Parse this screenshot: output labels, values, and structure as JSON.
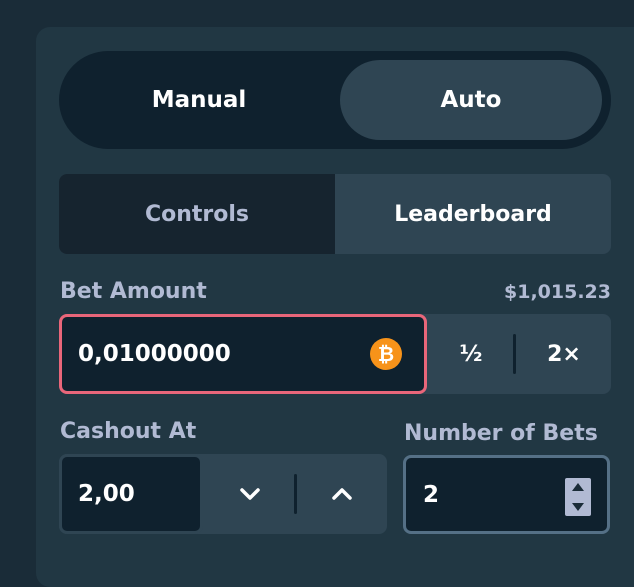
{
  "mode": {
    "manual_label": "Manual",
    "auto_label": "Auto",
    "selected": "Auto"
  },
  "tabs": {
    "controls_label": "Controls",
    "leaderboard_label": "Leaderboard",
    "selected": "Leaderboard"
  },
  "bet": {
    "label": "Bet Amount",
    "balance": "$1,015.23",
    "value": "0,01000000",
    "currency_icon": "bitcoin-icon",
    "half_label": "½",
    "double_label": "2×"
  },
  "cashout": {
    "label": "Cashout At",
    "value": "2,00",
    "decrease_icon": "chevron-down-icon",
    "increase_icon": "chevron-up-icon"
  },
  "number_of_bets": {
    "label": "Number of Bets",
    "value": "2"
  },
  "colors": {
    "background": "#1a2c38",
    "panel": "#213743",
    "input": "#0f212e",
    "button": "#2f4553",
    "accent_error": "#e9667a",
    "bitcoin": "#f7931a",
    "muted_text": "#b1bad3"
  }
}
